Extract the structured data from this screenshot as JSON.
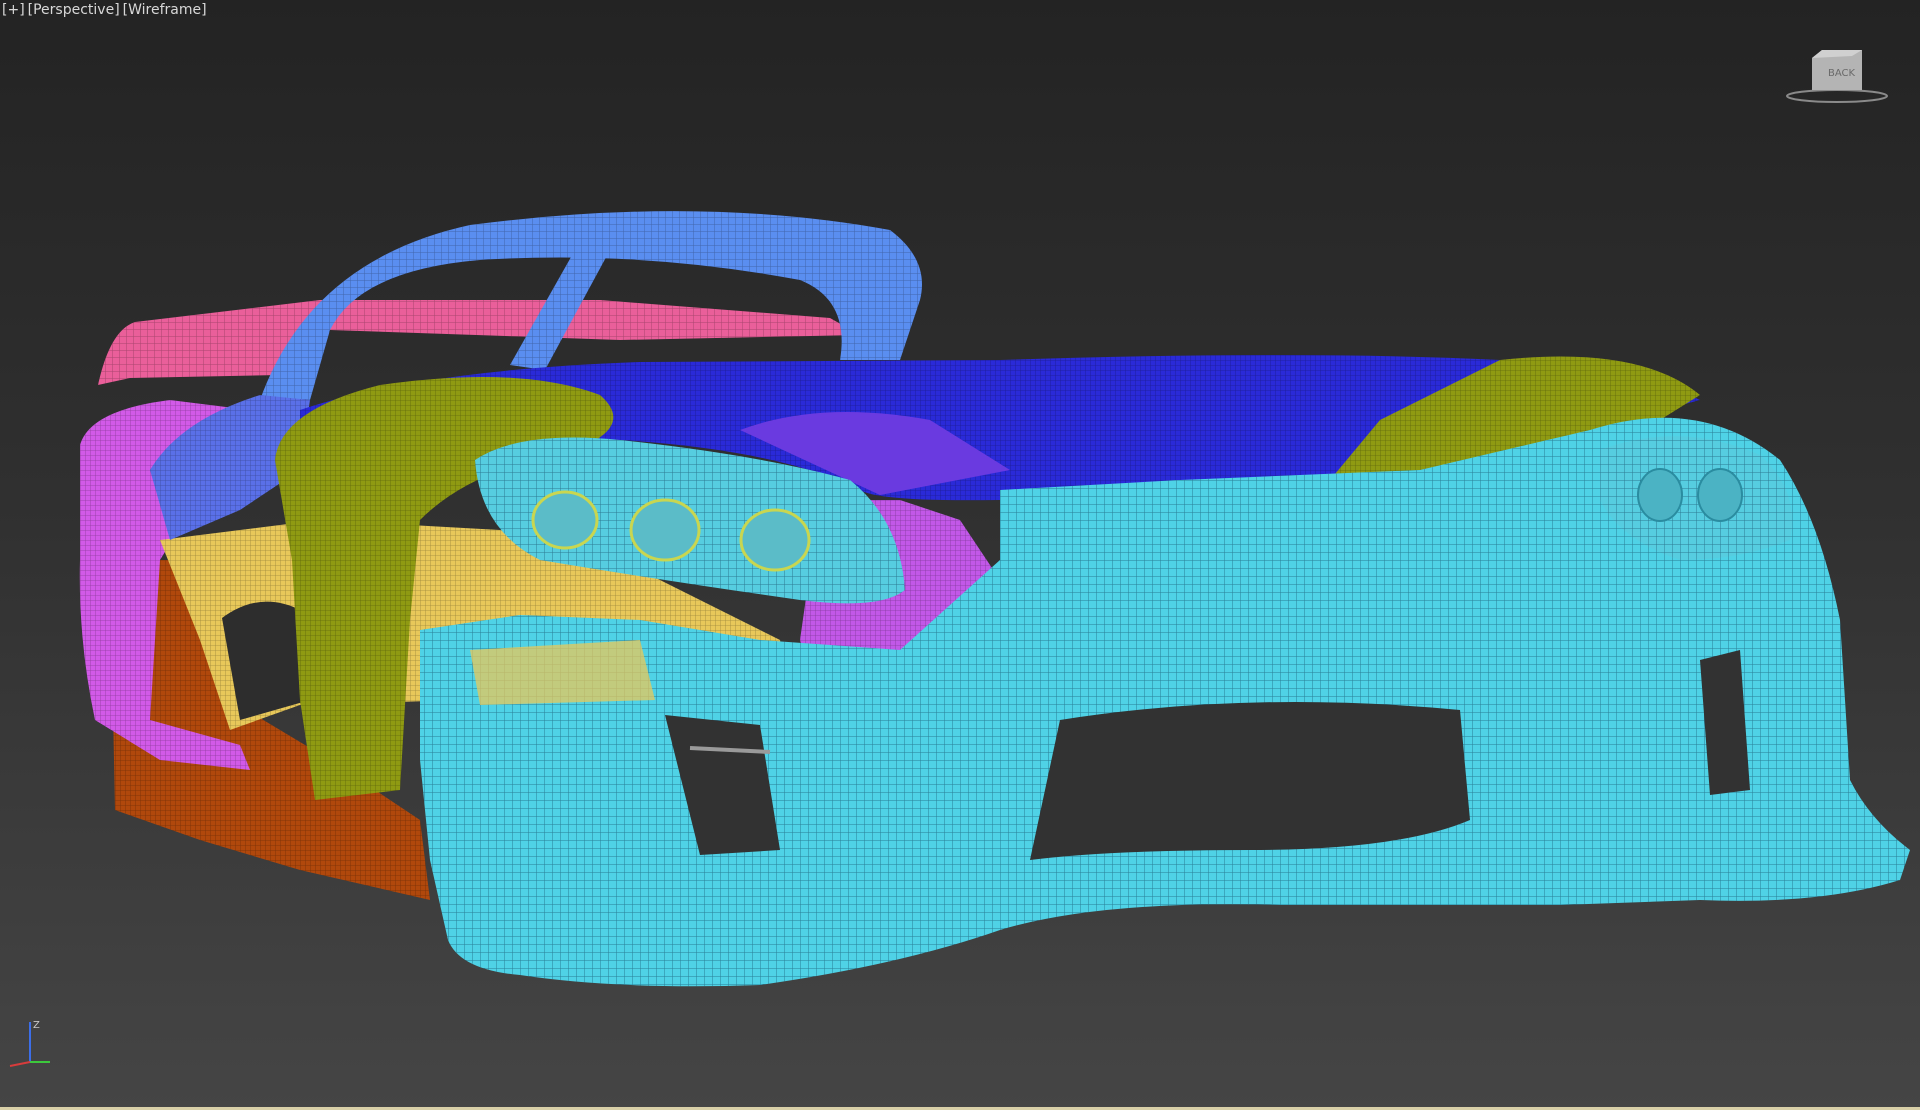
{
  "viewport": {
    "label_plus": "[+]",
    "label_view": "[Perspective]",
    "label_shading": "[Wireframe]"
  },
  "viewcube": {
    "face_label": "BACK"
  },
  "axis_tripod": {
    "z_label": "Z",
    "x_label": "",
    "y_label": ""
  },
  "colors": {
    "background_top": "#232323",
    "background_bottom": "#454545",
    "front_bumper": "#4fd2e6",
    "hood": "#2a2ad8",
    "roll_hoop": "#5a8ef0",
    "rear_wing": "#ea5f9a",
    "fender_olive": "#8f9a12",
    "side_magenta": "#d25ae8",
    "side_yellow": "#e8c85a",
    "lower_orange": "#b0480c",
    "z_axis": "#3c6ee8",
    "x_axis": "#d83c3c",
    "y_axis": "#3cc83c"
  }
}
